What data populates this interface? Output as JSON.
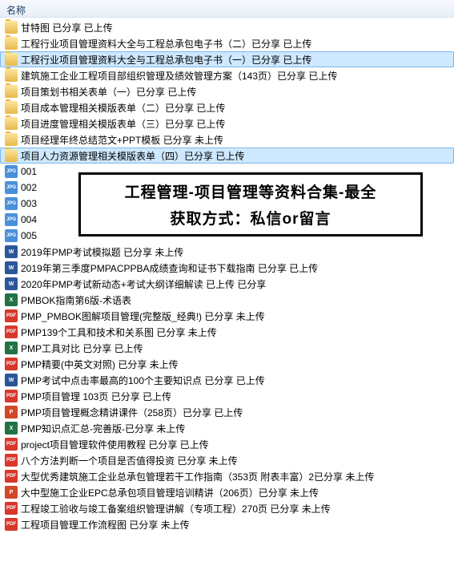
{
  "header": {
    "column_name": "名称"
  },
  "overlay": {
    "line1": "工程管理-项目管理等资料合集-最全",
    "line2": "获取方式：私信or留言"
  },
  "files": [
    {
      "type": "folder",
      "name": "甘特图 已分享 已上传",
      "selected": false
    },
    {
      "type": "folder",
      "name": "工程行业项目管理资料大全与工程总承包电子书（二）已分享 已上传",
      "selected": false
    },
    {
      "type": "folder",
      "name": "工程行业项目管理资料大全与工程总承包电子书（一）已分享 已上传",
      "selected": true
    },
    {
      "type": "folder",
      "name": "建筑施工企业工程项目部组织管理及绩效管理方案（143页）已分享 已上传",
      "selected": false
    },
    {
      "type": "folder",
      "name": "项目策划书相关表单（一）已分享 已上传",
      "selected": false
    },
    {
      "type": "folder",
      "name": "项目成本管理相关模版表单（二）已分享 已上传",
      "selected": false
    },
    {
      "type": "folder",
      "name": "项目进度管理相关模版表单（三）已分享 已上传",
      "selected": false
    },
    {
      "type": "folder",
      "name": "项目经理年终总结范文+PPT模板 已分享 未上传",
      "selected": false
    },
    {
      "type": "folder",
      "name": "项目人力资源管理相关模版表单（四）已分享 已上传",
      "selected": true
    },
    {
      "type": "jpg",
      "name": "001",
      "selected": false
    },
    {
      "type": "jpg",
      "name": "002",
      "selected": false
    },
    {
      "type": "jpg",
      "name": "003",
      "selected": false
    },
    {
      "type": "jpg",
      "name": "004",
      "selected": false
    },
    {
      "type": "jpg",
      "name": "005",
      "selected": false
    },
    {
      "type": "doc",
      "name": "2019年PMP考试模拟题 已分享 未上传",
      "selected": false
    },
    {
      "type": "doc",
      "name": "2019年第三季度PMPACPPBA成绩查询和证书下载指南 已分享 已上传",
      "selected": false
    },
    {
      "type": "doc",
      "name": "2020年PMP考试新动态+考试大纲详细解读 已上传 已分享",
      "selected": false
    },
    {
      "type": "xls",
      "name": "PMBOK指南第6版-术语表",
      "selected": false
    },
    {
      "type": "pdf",
      "name": "PMP_PMBOK图解项目管理(完整版_经典!) 已分享 未上传",
      "selected": false
    },
    {
      "type": "pdf",
      "name": "PMP139个工具和技术和关系图 已分享 未上传",
      "selected": false
    },
    {
      "type": "xls",
      "name": "PMP工具对比 已分享 已上传",
      "selected": false
    },
    {
      "type": "pdf",
      "name": "PMP精要(中英文对照) 已分享 未上传",
      "selected": false
    },
    {
      "type": "doc",
      "name": "PMP考试中点击率最高的100个主要知识点 已分享 已上传",
      "selected": false
    },
    {
      "type": "pdf",
      "name": "PMP项目管理 103页 已分享 已上传",
      "selected": false
    },
    {
      "type": "ppt",
      "name": "PMP项目管理概念精讲课件（258页）已分享 已上传",
      "selected": false
    },
    {
      "type": "xls",
      "name": "PMP知识点汇总-完善版-已分享 未上传",
      "selected": false
    },
    {
      "type": "pdf",
      "name": "project项目管理软件使用教程 已分享 已上传",
      "selected": false
    },
    {
      "type": "pdf",
      "name": "八个方法判断一个项目是否值得投资 已分享 未上传",
      "selected": false
    },
    {
      "type": "pdf",
      "name": "大型优秀建筑施工企业总承包管理若干工作指南（353页 附表丰富）2已分享 未上传",
      "selected": false
    },
    {
      "type": "ppt",
      "name": "大中型施工企业EPC总承包项目管理培训精讲（206页）已分享 未上传",
      "selected": false
    },
    {
      "type": "pdf",
      "name": "工程竣工验收与竣工备案组织管理讲解（专项工程）270页 已分享 未上传",
      "selected": false
    },
    {
      "type": "pdf",
      "name": "工程项目管理工作流程图 已分享 未上传",
      "selected": false
    }
  ],
  "icon_labels": {
    "jpg": "JPG",
    "doc": "W",
    "xls": "X",
    "pdf": "PDF",
    "ppt": "P"
  }
}
